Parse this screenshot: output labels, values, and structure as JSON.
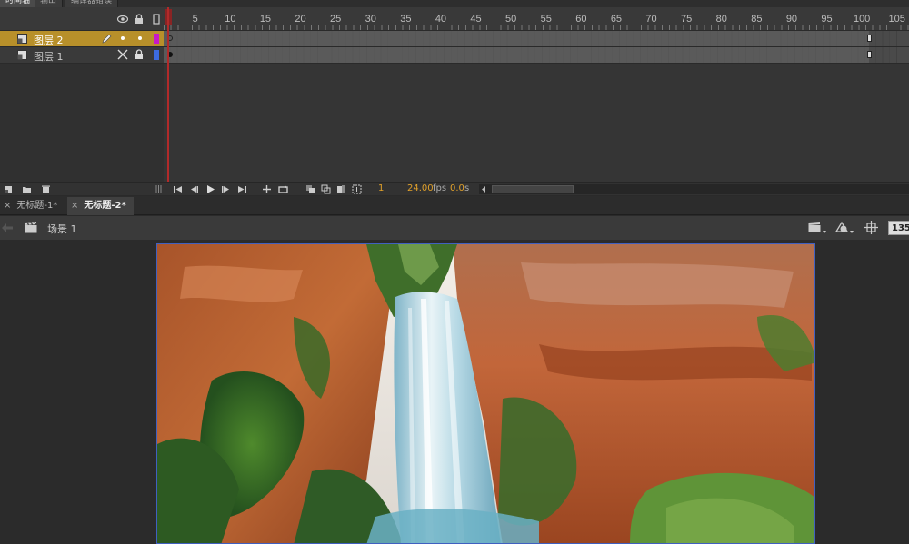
{
  "panel_tabs": [
    "时间轴",
    "输出",
    "编译器错误"
  ],
  "ruler": {
    "labels": [
      "1",
      "5",
      "10",
      "15",
      "20",
      "25",
      "30",
      "35",
      "40",
      "45",
      "50",
      "55",
      "60",
      "65",
      "70",
      "75",
      "80",
      "85",
      "90",
      "95",
      "100",
      "105"
    ],
    "values": [
      1,
      5,
      10,
      15,
      20,
      25,
      30,
      35,
      40,
      45,
      50,
      55,
      60,
      65,
      70,
      75,
      80,
      85,
      90,
      95,
      100,
      105
    ]
  },
  "header_icons": [
    "eye-icon",
    "lock-icon",
    "outline-icon"
  ],
  "layers": [
    {
      "name": "图层 2",
      "selected": true,
      "color": "#c818c8"
    },
    {
      "name": "图层 1",
      "selected": false,
      "color": "#3c6be0"
    }
  ],
  "toolbar": {
    "current_frame": "1",
    "fps": "24.00",
    "fps_unit": "fps",
    "time": "0.0",
    "time_unit": "s"
  },
  "doc_tabs": [
    {
      "label": "无标题-1*",
      "active": false
    },
    {
      "label": "无标题-2*",
      "active": true
    }
  ],
  "scene": {
    "label": "场景 1",
    "zoom": "135"
  },
  "colors": {
    "selected_layer": "#b8902a",
    "playhead": "#b12a2a",
    "accent_text": "#e0a02a"
  }
}
